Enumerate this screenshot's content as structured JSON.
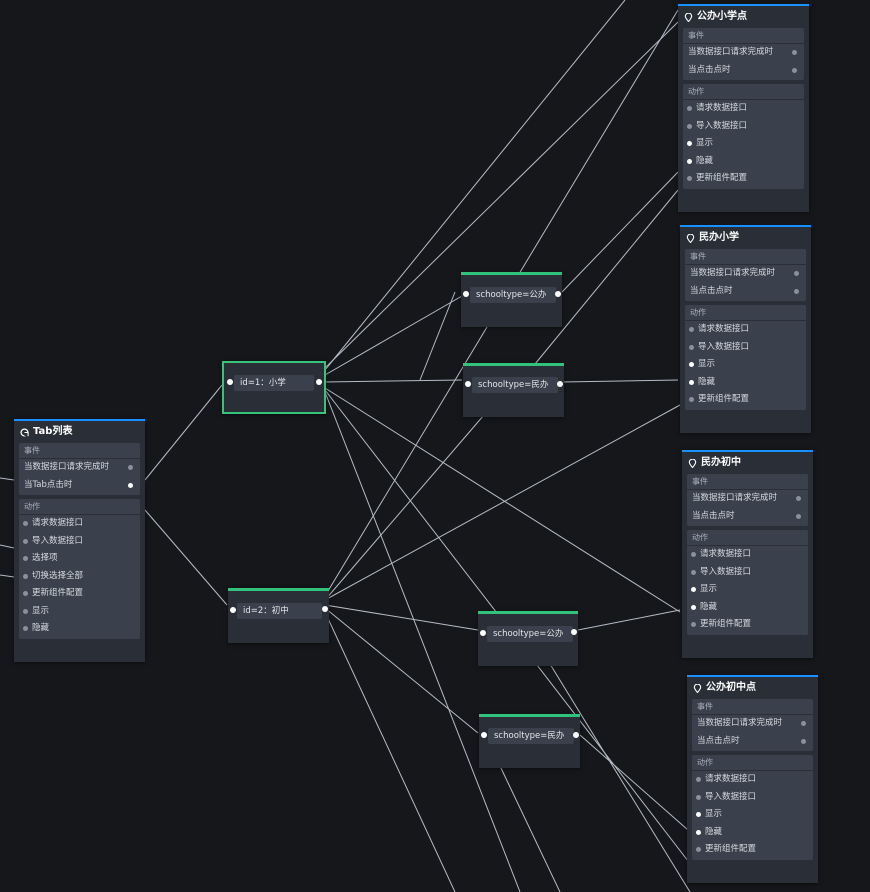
{
  "tab_node": {
    "title": "Tab列表",
    "events_title": "事件",
    "events": [
      "当数据接口请求完成时",
      "当Tab点击时"
    ],
    "actions_title": "动作",
    "actions": [
      "请求数据接口",
      "导入数据接口",
      "选择项",
      "切换选择全部",
      "更新组件配置",
      "显示",
      "隐藏"
    ]
  },
  "conditions": [
    {
      "label": "id=1：小学"
    },
    {
      "label": "id=2：初中"
    },
    {
      "label": "schooltype=公办"
    },
    {
      "label": "schooltype=民办"
    },
    {
      "label": "schooltype=公办"
    },
    {
      "label": "schooltype=民办"
    }
  ],
  "targets": [
    {
      "title": "公办小学点"
    },
    {
      "title": "民办小学"
    },
    {
      "title": "民办初中"
    },
    {
      "title": "公办初中点"
    }
  ],
  "target_sections": {
    "events_title": "事件",
    "events": [
      "当数据接口请求完成时",
      "当点击点时"
    ],
    "actions_title": "动作",
    "actions": [
      "请求数据接口",
      "导入数据接口",
      "显示",
      "隐藏",
      "更新组件配置"
    ]
  },
  "colors": {
    "background": "#15171b",
    "node_header_accent": "#1890ff",
    "condition_accent": "#31c27c",
    "wire": "#b6bcc6"
  },
  "icons": {
    "tab_node": "tab-list-icon",
    "target_node": "map-pin-icon"
  }
}
